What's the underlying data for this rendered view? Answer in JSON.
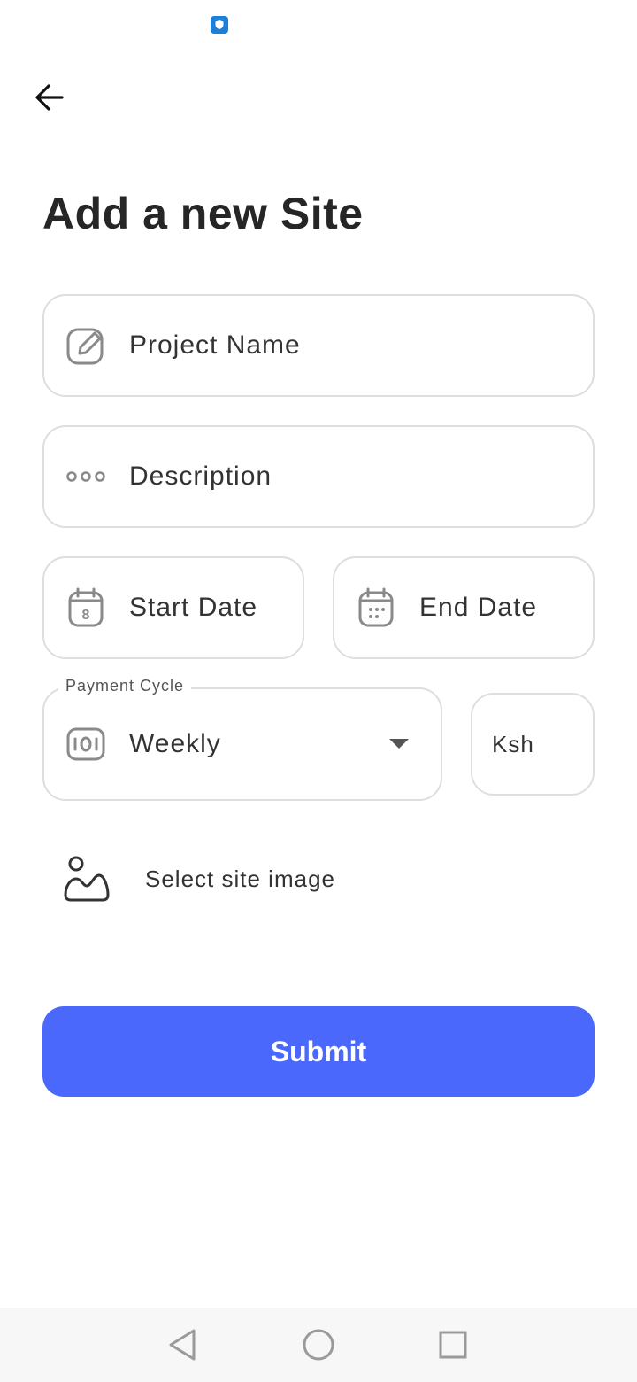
{
  "status_bar": {
    "icon": "shield-icon",
    "icon_color": "#1e7fd8"
  },
  "header": {
    "back_icon": "arrow-left-icon",
    "title": "Add a new Site"
  },
  "form": {
    "project_name": {
      "placeholder": "Project Name",
      "icon": "edit-icon"
    },
    "description": {
      "placeholder": "Description",
      "icon": "dots-icon"
    },
    "start_date": {
      "placeholder": "Start Date",
      "icon": "calendar-icon",
      "calendar_day": "8"
    },
    "end_date": {
      "placeholder": "End Date",
      "icon": "calendar-icon"
    },
    "payment_cycle": {
      "label": "Payment Cycle",
      "value": "Weekly",
      "icon": "money-icon"
    },
    "currency": {
      "value": "Ksh"
    },
    "site_image": {
      "label": "Select site image",
      "icon": "image-icon"
    }
  },
  "actions": {
    "submit_label": "Submit",
    "accent_color": "#4a68fb"
  },
  "nav": {
    "back": "nav-back-icon",
    "home": "nav-home-icon",
    "recents": "nav-recents-icon"
  }
}
